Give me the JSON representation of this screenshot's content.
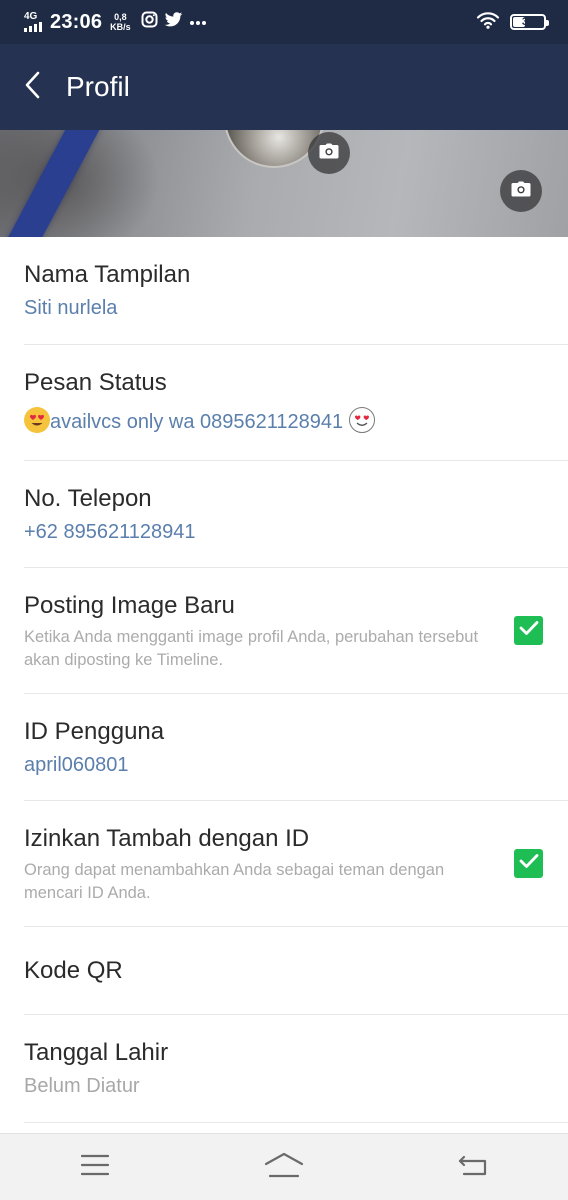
{
  "status_bar": {
    "network": "4G",
    "time": "23:06",
    "speed_value": "0,8",
    "speed_unit": "KB/s",
    "battery": "38",
    "battery_level": 0.38,
    "icons": [
      "instagram-icon",
      "twitter-icon",
      "more-dots-icon",
      "wifi-icon"
    ]
  },
  "app_bar": {
    "title": "Profil",
    "back_icon": "chevron-left-icon"
  },
  "cover": {
    "avatar_camera_icon": "camera-icon",
    "cover_camera_icon": "camera-icon"
  },
  "profile": {
    "display_name": {
      "label": "Nama Tampilan",
      "value": "Siti nurlela"
    },
    "status_message": {
      "label": "Pesan Status",
      "value": "availvcs only wa 0895621128941"
    },
    "phone": {
      "label": "No. Telepon",
      "value": "+62 895621128941"
    },
    "post_new_image": {
      "label": "Posting Image Baru",
      "description": "Ketika Anda mengganti image profil Anda, perubahan tersebut akan diposting ke Timeline.",
      "checked": true
    },
    "user_id": {
      "label": "ID Pengguna",
      "value": "april060801"
    },
    "allow_add_by_id": {
      "label": "Izinkan Tambah dengan ID",
      "description": "Orang dapat menambahkan Anda sebagai teman dengan mencari ID Anda.",
      "checked": true
    },
    "qr_code": {
      "label": "Kode QR"
    },
    "birthday": {
      "label": "Tanggal Lahir",
      "value": "Belum Diatur"
    }
  },
  "nav_bar": {
    "icons": [
      "menu-icon",
      "home-icon",
      "back-icon"
    ]
  },
  "colors": {
    "status_bar_bg": "#1f2b45",
    "app_bar_bg": "#253252",
    "link_value": "#5b7fad",
    "checkbox": "#1fbe55"
  }
}
